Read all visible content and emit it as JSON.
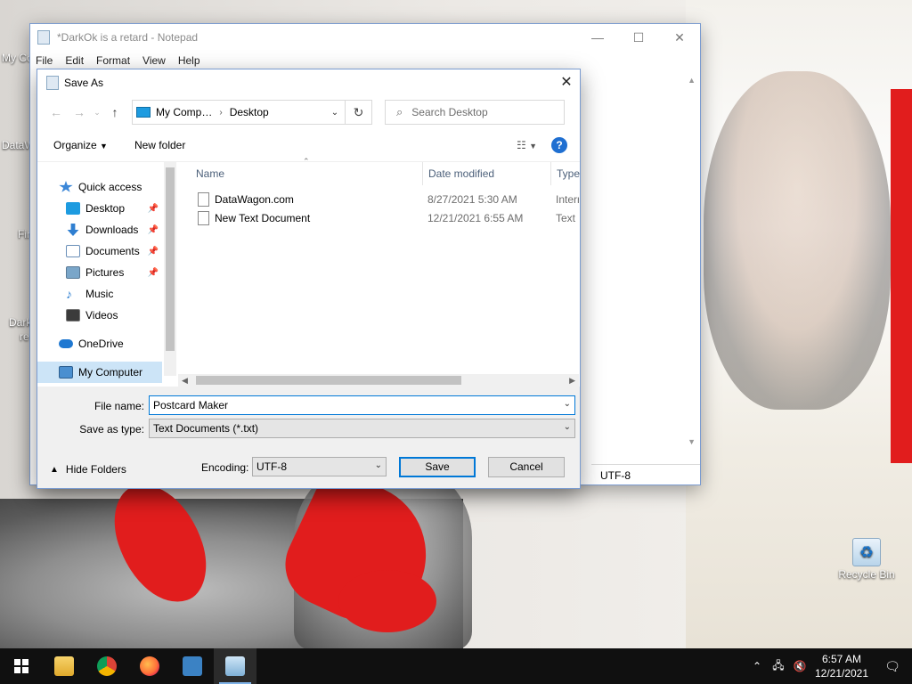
{
  "notepad": {
    "title": "*DarkOk is a retard - Notepad",
    "menu": [
      "File",
      "Edit",
      "Format",
      "View",
      "Help"
    ],
    "status_encoding": "UTF-8"
  },
  "dialog": {
    "title": "Save As",
    "address": {
      "root": "My Comp…",
      "current": "Desktop"
    },
    "search_placeholder": "Search Desktop",
    "toolbar": {
      "organize": "Organize",
      "new_folder": "New folder",
      "help": "?"
    },
    "nav": {
      "quick_access": "Quick access",
      "items": [
        {
          "label": "Desktop",
          "pinned": true
        },
        {
          "label": "Downloads",
          "pinned": true
        },
        {
          "label": "Documents",
          "pinned": true
        },
        {
          "label": "Pictures",
          "pinned": true
        },
        {
          "label": "Music",
          "pinned": false
        },
        {
          "label": "Videos",
          "pinned": false
        }
      ],
      "onedrive": "OneDrive",
      "my_computer": "My Computer"
    },
    "columns": {
      "name": "Name",
      "date": "Date modified",
      "type": "Type"
    },
    "files": [
      {
        "name": "DataWagon.com",
        "date": "8/27/2021 5:30 AM",
        "type": "Interr"
      },
      {
        "name": "New Text Document",
        "date": "12/21/2021 6:55 AM",
        "type": "Text D"
      }
    ],
    "file_name_label": "File name:",
    "file_name_value": "Postcard Maker",
    "save_type_label": "Save as type:",
    "save_type_value": "Text Documents (*.txt)",
    "encoding_label": "Encoding:",
    "encoding_value": "UTF-8",
    "hide_folders": "Hide Folders",
    "save": "Save",
    "cancel": "Cancel"
  },
  "desktop": {
    "recycle_bin": "Recycle Bin",
    "partial_labels": [
      "My Co",
      "DataW",
      "Fir",
      "Dark",
      "re"
    ]
  },
  "taskbar": {
    "time": "6:57 AM",
    "date": "12/21/2021"
  }
}
